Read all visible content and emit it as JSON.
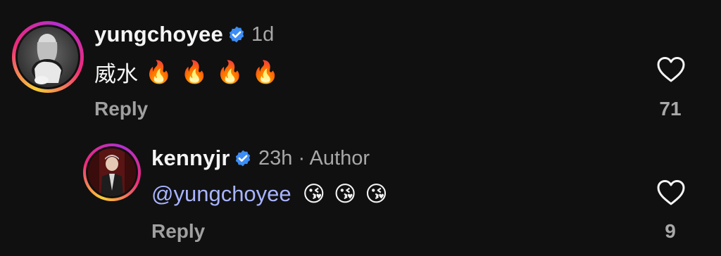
{
  "comments": [
    {
      "username": "yungchoyee",
      "time": "1d",
      "text": "威水",
      "emojis": [
        "🔥",
        "🔥",
        "🔥",
        "🔥"
      ],
      "reply_label": "Reply",
      "likes": "71",
      "verified": true
    },
    {
      "username": "kennyjr",
      "time": "23h · Author",
      "mention": "@yungchoyee",
      "emojis": [
        "😘",
        "😘",
        "😘"
      ],
      "reply_label": "Reply",
      "likes": "9",
      "verified": true
    }
  ],
  "colors": {
    "background": "#101010",
    "verified_badge": "#3d8df5",
    "mention": "#a8b4ff",
    "muted_text": "#a8a8a8"
  },
  "icons": {
    "verified": "verified-badge-icon",
    "like": "heart-outline-icon"
  }
}
